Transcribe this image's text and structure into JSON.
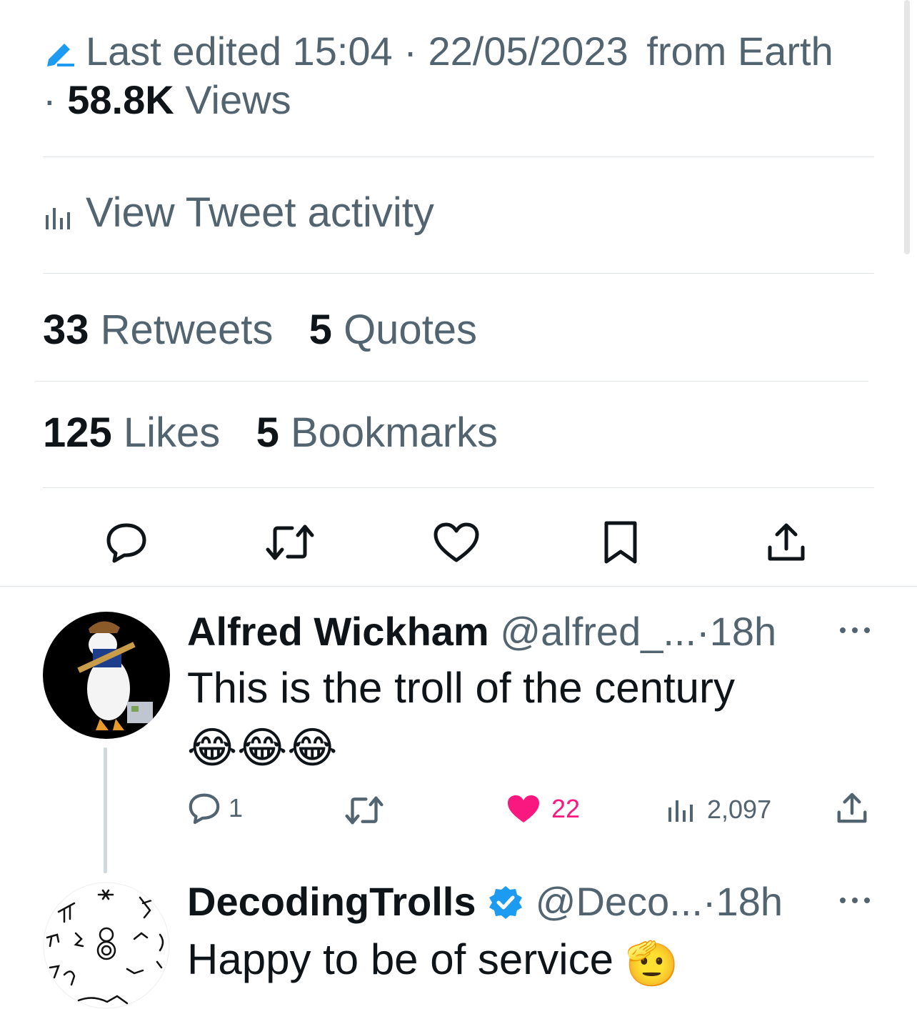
{
  "meta": {
    "edited_prefix": "Last edited",
    "time": "15:04",
    "separator": "·",
    "date": "22/05/2023",
    "source": "from Earth",
    "views_count": "58.8K",
    "views_label": "Views"
  },
  "activity_label": "View Tweet activity",
  "stats": {
    "retweets_count": "33",
    "retweets_label": "Retweets",
    "quotes_count": "5",
    "quotes_label": "Quotes",
    "likes_count": "125",
    "likes_label": "Likes",
    "bookmarks_count": "5",
    "bookmarks_label": "Bookmarks"
  },
  "icons": {
    "edit": "pencil-icon",
    "activity": "analytics-icon",
    "reply": "reply-icon",
    "retweet": "retweet-icon",
    "like": "heart-icon",
    "bookmark": "bookmark-icon",
    "share": "share-icon",
    "views": "analytics-icon",
    "verified": "verified-badge-icon",
    "more": "more-icon"
  },
  "colors": {
    "text": "#0f1419",
    "muted": "#536471",
    "like": "#f91880",
    "verified": "#1d9bf0",
    "divider": "#e1e6ea"
  },
  "replies": [
    {
      "name": "Alfred Wickham",
      "handle": "@alfred_...",
      "time": "18h",
      "text": "This is the troll of the century",
      "emoji": "😂😂😂",
      "reply_count": "1",
      "like_count": "22",
      "views_count": "2,097",
      "liked": true
    },
    {
      "name": "DecodingTrolls",
      "handle": "@Deco...",
      "time": "18h",
      "text": "Happy to be of service",
      "emoji": "🫡",
      "verified": true
    }
  ]
}
